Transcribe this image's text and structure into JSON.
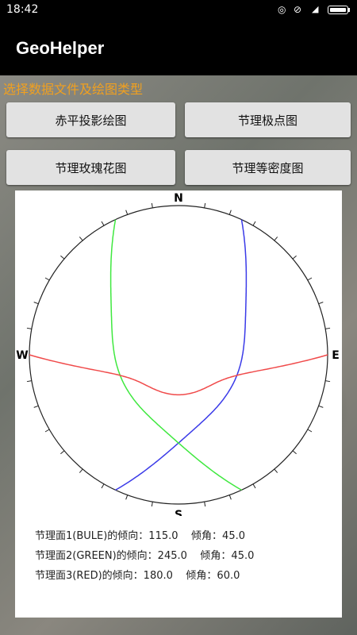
{
  "status_bar": {
    "time": "18:42",
    "icons": [
      "alarm-icon",
      "do-not-disturb-icon",
      "signal-icon",
      "battery-icon"
    ]
  },
  "app_bar": {
    "title": "GeoHelper"
  },
  "prompt": "选择数据文件及绘图类型",
  "buttons": {
    "stereographic": "赤平投影绘图",
    "joint_pole": "节理极点图",
    "joint_rose": "节理玫瑰花图",
    "joint_density": "节理等密度图"
  },
  "stereonet": {
    "directions": {
      "north": "N",
      "south": "S",
      "west": "W",
      "east": "E"
    },
    "planes": [
      {
        "label": "节理面1(BULE)的倾向：115.0    倾角：45.0",
        "color_name": "BULE",
        "dip_direction": 115.0,
        "dip": 45.0,
        "color": "#3a3ae8"
      },
      {
        "label": "节理面2(GREEN)的倾向：245.0    倾角：45.0",
        "color_name": "GREEN",
        "dip_direction": 245.0,
        "dip": 45.0,
        "color": "#3fe83f"
      },
      {
        "label": "节理面3(RED)的倾向：180.0    倾角：60.0",
        "color_name": "RED",
        "dip_direction": 180.0,
        "dip": 60.0,
        "color": "#f04a4a"
      }
    ]
  }
}
